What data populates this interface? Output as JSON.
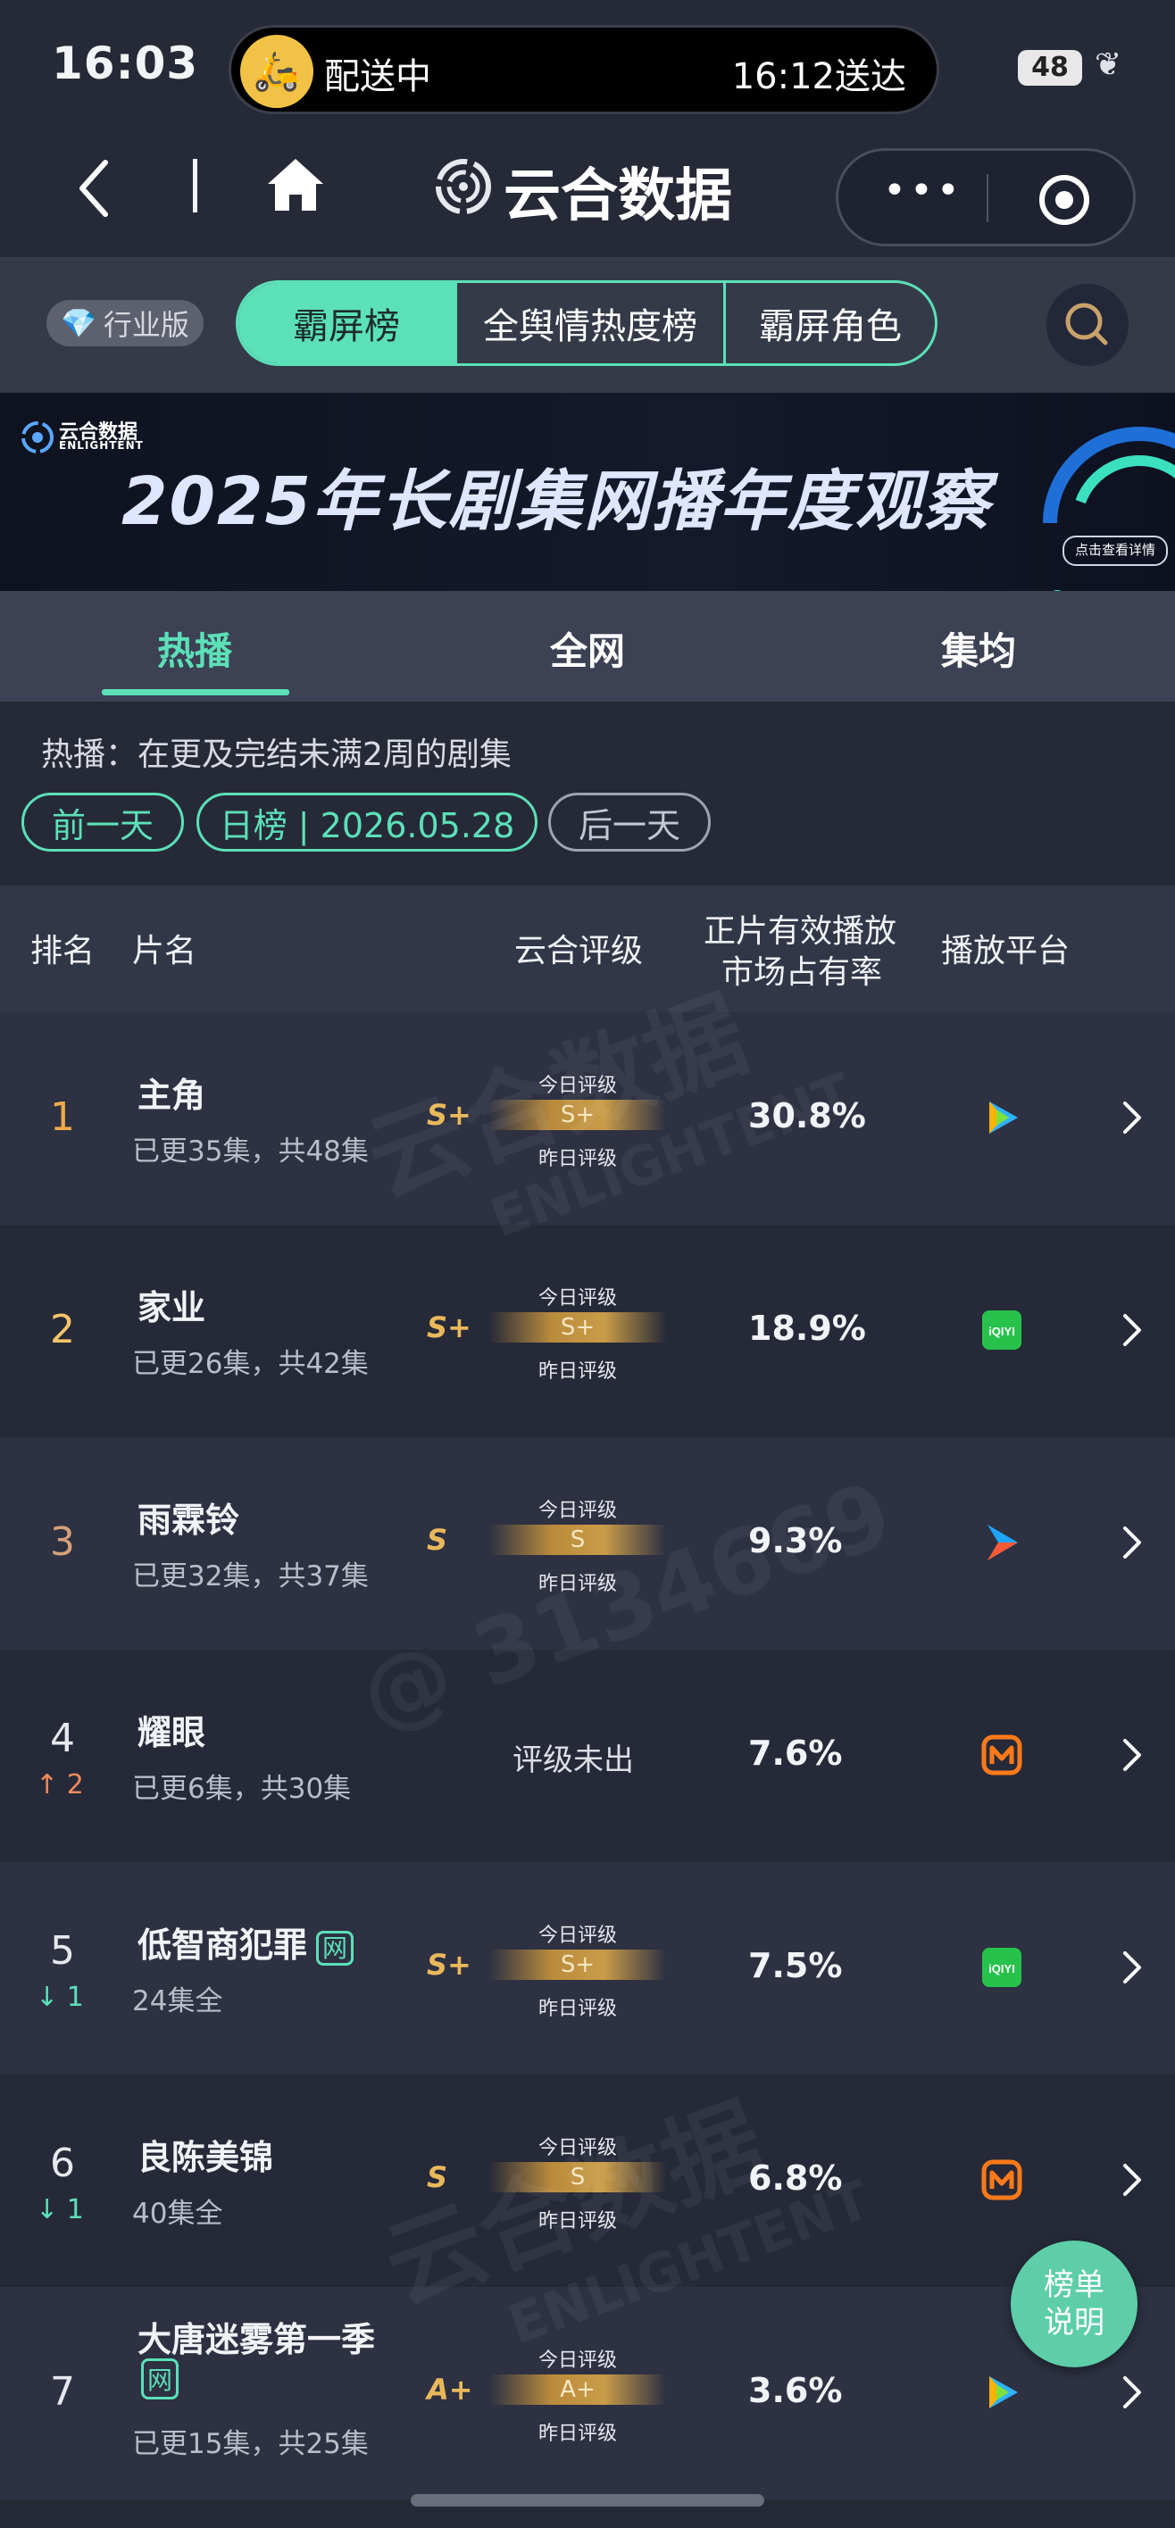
{
  "status_bar": {
    "time": "16:03",
    "delivery_status": "配送中",
    "delivery_eta": "16:12送达",
    "battery": "48"
  },
  "nav": {
    "app_title": "云合数据"
  },
  "header": {
    "edition_label": "行业版",
    "tabs": [
      {
        "label": "霸屏榜"
      },
      {
        "label": "全舆情热度榜"
      },
      {
        "label": "霸屏角色"
      }
    ]
  },
  "banner": {
    "brand": "云合数据",
    "brand_en": "ENLIGHTENT",
    "title": "2025年长剧集网播年度观察",
    "detail_chip": "点击查看详情"
  },
  "subtabs": [
    {
      "label": "热播"
    },
    {
      "label": "全网"
    },
    {
      "label": "集均"
    }
  ],
  "filter": {
    "description": "热播：在更及完结未满2周的剧集",
    "prev_day": "前一天",
    "date_label": "日榜 | 2026.05.28",
    "next_day": "后一天"
  },
  "table": {
    "headers": {
      "rank": "排名",
      "title": "片名",
      "grade": "云合评级",
      "share_line1": "正片有效播放",
      "share_line2": "市场占有率",
      "platform": "播放平台"
    },
    "today_grade_label": "今日评级",
    "yesterday_grade_label": "昨日评级",
    "net_badge": "网",
    "rows": [
      {
        "rank": "1",
        "title": "主角",
        "episodes": "已更35集，共48集",
        "grade": "S+",
        "share": "30.8%",
        "platform": "tencent-video-icon",
        "trend": "",
        "trend_dir": ""
      },
      {
        "rank": "2",
        "title": "家业",
        "episodes": "已更26集，共42集",
        "grade": "S+",
        "share": "18.9%",
        "platform": "iqiyi-icon",
        "trend": "",
        "trend_dir": ""
      },
      {
        "rank": "3",
        "title": "雨霖铃",
        "episodes": "已更32集，共37集",
        "grade": "S",
        "share": "9.3%",
        "platform": "youku-icon",
        "trend": "",
        "trend_dir": ""
      },
      {
        "rank": "4",
        "title": "耀眼",
        "episodes": "已更6集，共30集",
        "grade": "",
        "grade_none": "评级未出",
        "share": "7.6%",
        "platform": "mango-tv-icon",
        "trend": "2",
        "trend_dir": "up"
      },
      {
        "rank": "5",
        "title": "低智商犯罪",
        "episodes": "24集全",
        "grade": "S+",
        "share": "7.5%",
        "platform": "iqiyi-icon",
        "trend": "1",
        "trend_dir": "down",
        "net": true
      },
      {
        "rank": "6",
        "title": "良陈美锦",
        "episodes": "40集全",
        "grade": "S",
        "share": "6.8%",
        "platform": "mango-tv-icon",
        "trend": "1",
        "trend_dir": "down"
      },
      {
        "rank": "7",
        "title": "大唐迷雾第一季",
        "episodes": "已更15集，共25集",
        "grade": "A+",
        "share": "3.6%",
        "platform": "tencent-video-icon",
        "trend": "",
        "trend_dir": "",
        "net": true
      }
    ]
  },
  "watermark": {
    "brand": "云合数据",
    "brand_en": "ENLIGHTENT",
    "handle": "@ 3134669"
  },
  "help_button": "榜单说明",
  "colors": {
    "accent": "#5ce0b8",
    "background": "#262a37",
    "grade_gold": "#e9b85b"
  }
}
